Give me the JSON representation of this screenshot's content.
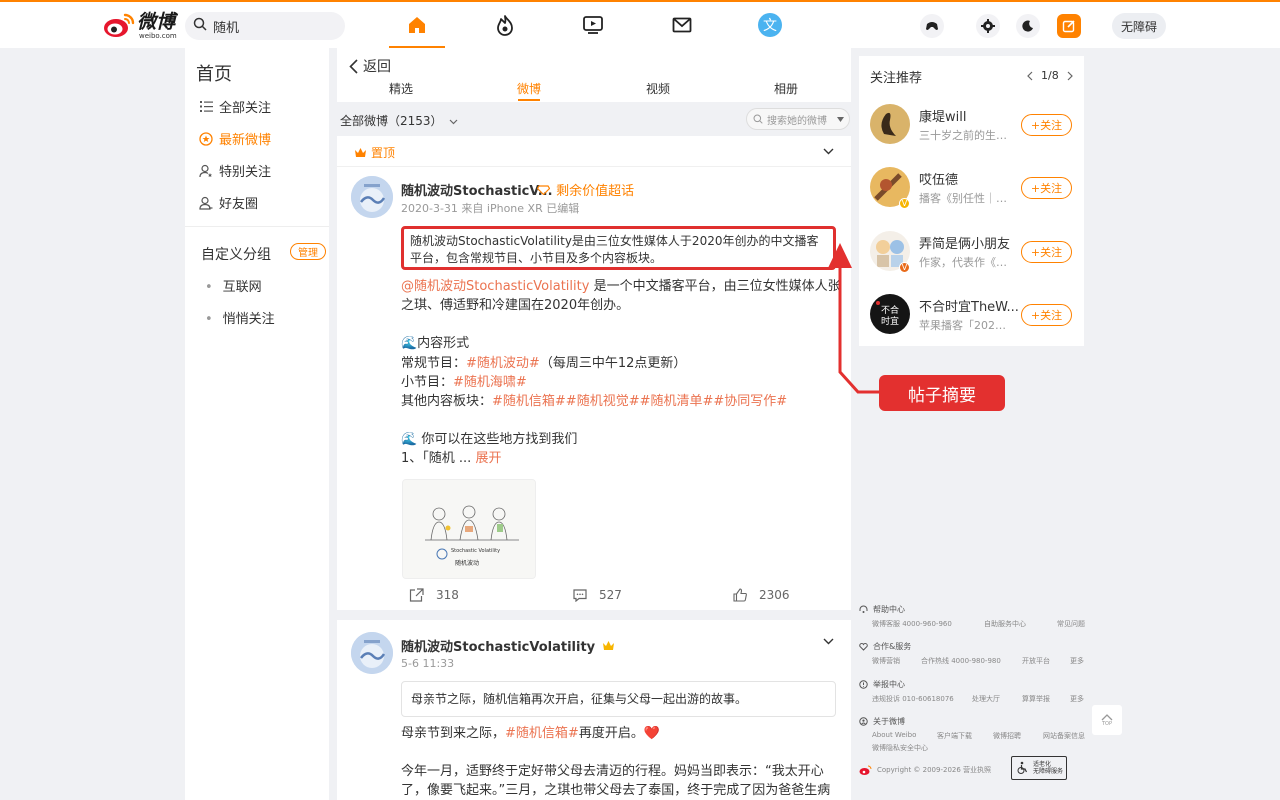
{
  "header": {
    "logo_cn": "微博",
    "logo_en": "weibo.com",
    "search_value": "随机",
    "accessibility_label": "无障碍"
  },
  "leftnav": {
    "home": "首页",
    "items": [
      {
        "label": "全部关注",
        "icon": "list-icon"
      },
      {
        "label": "最新微博",
        "icon": "star-circle-icon"
      },
      {
        "label": "特别关注",
        "icon": "user-star-icon"
      },
      {
        "label": "好友圈",
        "icon": "users-icon"
      }
    ],
    "group_title": "自定义分组",
    "manage_label": "管理",
    "groups": [
      "互联网",
      "悄悄关注"
    ]
  },
  "main": {
    "back_label": "返回",
    "tabs": [
      "精选",
      "微博",
      "视频",
      "相册"
    ],
    "active_tab": "微博",
    "filter_label": "全部微博（2153）",
    "filter_search_placeholder": "搜索她的微博",
    "pinned_label": "置顶",
    "post1": {
      "name": "随机波动StochasticV...",
      "super_topic": "剩余价值超话",
      "meta": "2020-3-31  来自 iPhone XR  已编辑",
      "summary": "随机波动StochasticVolatility是由三位女性媒体人于2020年创办的中文播客平台，包含常规节目、小节目及多个内容板块。",
      "mention": "@随机波动StochasticVolatility",
      "line1_rest": " 是一个中文播客平台，由三位女性媒体人张之琪、傅适野和冷建国在2020年创办。",
      "section1": "🌊内容形式",
      "regular_label": "常规节目：",
      "regular_tag": "#随机波动#",
      "regular_note": "（每周三中午12点更新）",
      "mini_label": "小节目：",
      "mini_tag": "#随机海啸#",
      "other_label": "其他内容板块：",
      "other_tags": "#随机信箱##随机视觉##随机清单##协同写作#",
      "section2": "🌊 你可以在这些地方找到我们",
      "truncated": "1、「随机 ...",
      "expand": "展开",
      "thumb_caption": "Stochastic Volatility",
      "thumb_cn": "随机波动",
      "reposts": "318",
      "comments": "527",
      "likes": "2306"
    },
    "post2": {
      "name": "随机波动StochasticVolatility",
      "meta": "5-6 11:33",
      "summary": "母亲节之际，随机信箱再次开启，征集与父母一起出游的故事。",
      "line1_a": "母亲节到来之际，",
      "line1_tag": "#随机信箱#",
      "line1_b": "再度开启。❤️",
      "line2": "今年一月，适野终于定好带父母去清迈的行程。妈妈当即表示：“我太开心了，像要飞起来。”三月，之琪也带父母去了泰国，终于完成了因为爸爸生病而耽误了三年"
    }
  },
  "follow": {
    "title": "关注推荐",
    "pager": "1/8",
    "follow_label": "+关注",
    "items": [
      {
        "name": "康堤will",
        "desc": "三十岁之前的生活..."
      },
      {
        "name": "哎伍德",
        "desc": "播客《别任性｜Be..."
      },
      {
        "name": "弄简是俩小朋友",
        "desc": "作家，代表作《陌..."
      },
      {
        "name": "不合时宜TheW...",
        "desc": "苹果播客「2020..."
      }
    ]
  },
  "footer": {
    "help": "帮助中心",
    "help_links": [
      "微博客服 4000-960-960",
      "自助服务中心",
      "常见问题"
    ],
    "coop": "合作&服务",
    "coop_links": [
      "微博营销",
      "合作热线 4000-980-980",
      "开放平台",
      "更多"
    ],
    "report": "举报中心",
    "report_links": [
      "违规投诉 010-60618076",
      "处理大厅",
      "算算举报",
      "更多"
    ],
    "about": "关于微博",
    "about_links": [
      "About Weibo",
      "客户端下载",
      "微博招聘",
      "网站备案信息",
      "微博隐私安全中心"
    ],
    "copyright": "Copyright © 2009-2026 营业执照",
    "elder_line1": "适老化",
    "elder_line2": "无障碍服务",
    "totop": "TOP"
  },
  "annotation": {
    "label": "帖子摘要",
    "color": "#e3302f"
  },
  "colors": {
    "accent": "#ff8200",
    "tag": "#eb7350"
  }
}
